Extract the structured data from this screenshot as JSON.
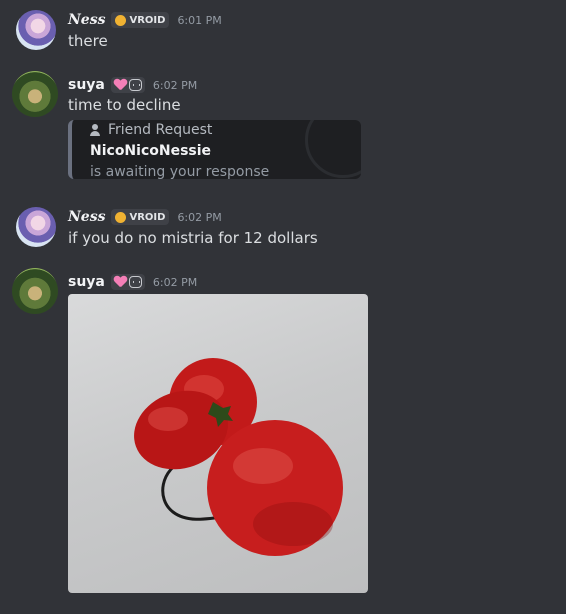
{
  "messages": [
    {
      "author": "Ness",
      "badge": "VROID",
      "time": "6:01 PM",
      "text": "there"
    },
    {
      "author": "suya",
      "time": "6:02 PM",
      "text": "time to decline",
      "embed": {
        "header": "Friend Request",
        "title": "NicoNicoNessie",
        "subtitle": "is awaiting your response"
      }
    },
    {
      "author": "Ness",
      "badge": "VROID",
      "time": "6:02 PM",
      "text": "if you do no mistria for 12 dollars"
    },
    {
      "author": "suya",
      "time": "6:02 PM",
      "attachment": "image"
    }
  ],
  "icons": [
    "user-icon",
    "heart-icon",
    "face-icon",
    "badge-dot-icon"
  ],
  "colors": {
    "background": "#313338",
    "embed_bg": "#1e1f22",
    "text": "#dbdee1",
    "muted": "#949ba4",
    "tomato": "#c81f1f"
  }
}
